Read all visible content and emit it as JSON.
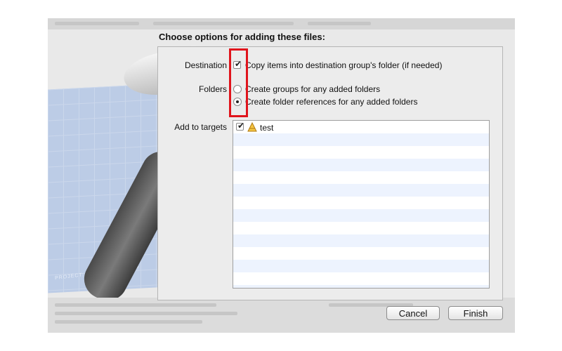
{
  "dialog": {
    "title": "Choose options for adding these files:",
    "blueprint_caption": "PROJECT: APPLICATION APP"
  },
  "options": {
    "destination": {
      "label": "Destination",
      "checkbox_label": "Copy items into destination group's folder (if needed)",
      "checked": true
    },
    "folders": {
      "label": "Folders",
      "choices": [
        {
          "label": "Create groups for any added folders",
          "selected": false
        },
        {
          "label": "Create folder references for any added folders",
          "selected": true
        }
      ]
    },
    "targets": {
      "label": "Add to targets",
      "items": [
        {
          "name": "test",
          "checked": true,
          "icon": "app-target-icon"
        }
      ]
    }
  },
  "buttons": {
    "cancel": "Cancel",
    "finish": "Finish"
  },
  "colors": {
    "highlight": "#e0141c",
    "list_stripe": "#edf3fe"
  }
}
